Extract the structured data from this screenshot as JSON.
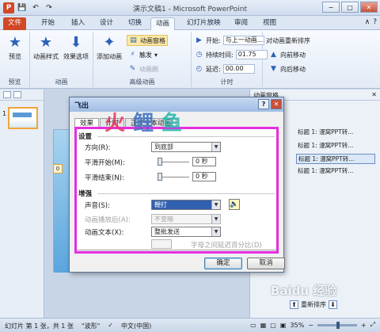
{
  "window": {
    "title": "演示文稿1 - Microsoft PowerPoint",
    "logo": "P",
    "controls": [
      "−",
      "□",
      "✕"
    ]
  },
  "ribbon_tabs": [
    "文件",
    "开始",
    "插入",
    "设计",
    "切换",
    "动画",
    "幻灯片放映",
    "审阅",
    "视图"
  ],
  "active_tab": "动画",
  "ribbon": {
    "preview_label": "预览",
    "preview_group": "预览",
    "anim_style_label": "动画样式",
    "effect_options_label": "效果选项",
    "anim_group": "动画",
    "add_anim_label": "添加动画",
    "anim_pane_label": "动画窗格",
    "trigger_label": "触发",
    "anim_painter_label": "动画刷",
    "advanced_group": "高级动画",
    "start_label": "开始:",
    "start_value": "与上一动画...",
    "duration_label": "持续时间:",
    "duration_value": "01.75",
    "delay_label": "延迟:",
    "delay_value": "00.00",
    "timing_group": "计时",
    "reorder_title": "对动画重新排序",
    "move_earlier": "向前移动",
    "move_later": "向后移动"
  },
  "slide_pane": {
    "slide_number": "1"
  },
  "editor": {
    "marker": "0"
  },
  "anim_pane": {
    "title": "动画窗格",
    "items": [
      "标题 1: 漫窝PPT转...",
      "标题 1: 漫窝PPT转...",
      "标题 1: 漫窝PPT转...",
      "标题 1: 漫窝PPT转..."
    ],
    "selected_index": 2,
    "reorder_label": "重新排序"
  },
  "dialog": {
    "title": "飞出",
    "help": "?",
    "close": "✕",
    "tabs": [
      "效果",
      "计时",
      "正文文本动画"
    ],
    "active_tab": "效果",
    "settings_section": "设置",
    "direction_label": "方向(R):",
    "direction_value": "到底部",
    "smooth_start_label": "平滑开始(M):",
    "smooth_start_value": "0 秒",
    "smooth_end_label": "平滑结束(N):",
    "smooth_end_value": "0 秒",
    "enhance_section": "增强",
    "sound_label": "声音(S):",
    "sound_value": "鞭打",
    "after_anim_label": "动画播放后(A):",
    "after_anim_value": "不变暗",
    "anim_text_label": "动画文本(X):",
    "anim_text_value": "整批发送",
    "letter_delay_label": "字母之间延迟百分比(D)",
    "ok_label": "确定",
    "cancel_label": "取消"
  },
  "watermark": {
    "chars": [
      "火",
      "鲤",
      "鱼"
    ],
    "baidu": "Baidu 经验"
  },
  "statusbar": {
    "slide_info": "幻灯片 第 1 张，共 1 张",
    "theme": "\"波形\"",
    "language": "中文(中国)",
    "zoom": "35%"
  },
  "colors": {
    "file_tab": "#d24726",
    "highlight_border": "#e62ee0",
    "accent_blue": "#2a63b8"
  }
}
